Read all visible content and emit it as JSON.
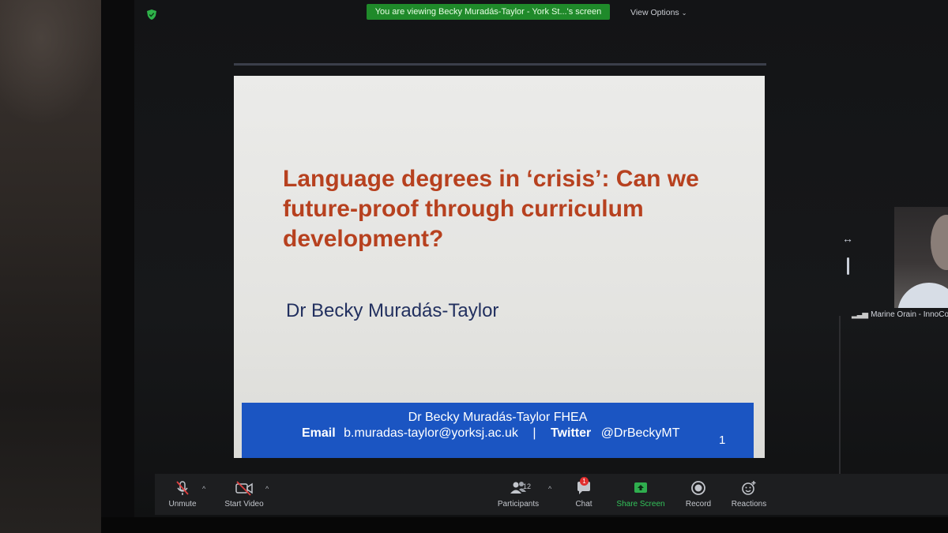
{
  "banner": {
    "text": "You are viewing Becky Muradás-Taylor - York St...'s screen"
  },
  "top": {
    "view_options": "View Options"
  },
  "slide": {
    "title": "Language degrees in ‘crisis’: Can we future-proof through curriculum development?",
    "author": "Dr Becky Muradás-Taylor",
    "footer_name": "Dr Becky Muradás-Taylor FHEA",
    "email_label": "Email",
    "email": "b.muradas-taylor@yorksj.ac.uk",
    "separator": "|",
    "twitter_label": "Twitter",
    "twitter": "@DrBeckyMT",
    "page_number": "1"
  },
  "participant": {
    "name": "Marine Orain - InnoCo"
  },
  "toolbar": {
    "unmute": "Unmute",
    "start_video": "Start Video",
    "participants": "Participants",
    "participants_count": "12",
    "chat": "Chat",
    "chat_badge": "1",
    "share_screen": "Share Screen",
    "record": "Record",
    "reactions": "Reactions"
  },
  "colors": {
    "title": "#b7411f",
    "author": "#22305f",
    "footer": "#1b55c2",
    "banner": "#1f8a2a",
    "share": "#33c35a"
  }
}
